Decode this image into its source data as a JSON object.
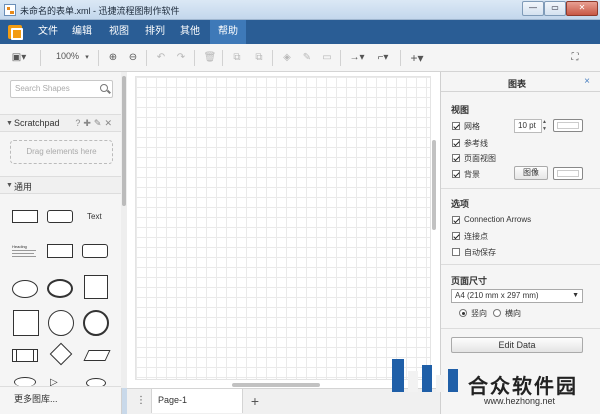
{
  "window": {
    "title": "未命名的表单.xml - 迅捷流程图制作软件",
    "min_label": "—",
    "max_label": "▭",
    "close_label": "✕"
  },
  "menu": {
    "items": [
      "文件",
      "编辑",
      "视图",
      "排列",
      "其他",
      "帮助"
    ],
    "active_index": 5
  },
  "toolbar": {
    "zoom": "100%"
  },
  "left_panel": {
    "search_placeholder": "Search Shapes",
    "scratchpad_title": "Scratchpad",
    "scratchpad_icons": "?✚✎✕",
    "drag_hint": "Drag elements here",
    "general_title": "通用",
    "text_shape_label": "Text",
    "heading_shape_label": "Heading",
    "more_shapes": "更多图库..."
  },
  "page_bar": {
    "page_tab": "Page-1",
    "add_label": "+",
    "menu_label": "⋮"
  },
  "right_panel": {
    "tab_title": "图表",
    "close_label": "×",
    "view_title": "视图",
    "grid_label": "网格",
    "grid_size": "10 pt",
    "guides_label": "参考线",
    "page_view_label": "页面视图",
    "background_label": "背景",
    "image_button": "图像",
    "options_title": "选项",
    "connection_arrows_label": "Connection Arrows",
    "connection_points_label": "连接点",
    "autosave_label": "自动保存",
    "page_size_title": "页面尺寸",
    "page_size_value": "A4 (210 mm x 297 mm)",
    "portrait_label": "竖向",
    "landscape_label": "横向",
    "edit_data_button": "Edit Data",
    "checks": {
      "grid": true,
      "guides": true,
      "page_view": true,
      "background": true,
      "connection_arrows": true,
      "connection_points": true,
      "autosave": false
    },
    "orientation": "portrait"
  },
  "watermark": {
    "text": "合众软件园",
    "url": "www.hezhong.net"
  }
}
